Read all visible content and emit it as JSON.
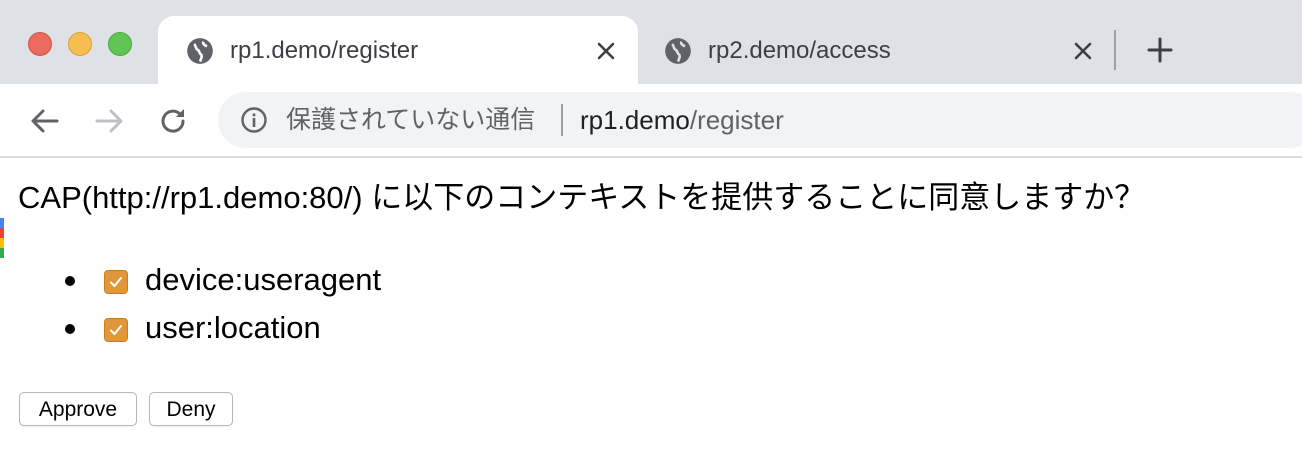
{
  "window_controls": {
    "close_color": "#ed6a5e",
    "minimize_color": "#f5be4f",
    "zoom_color": "#61c554"
  },
  "tabs": [
    {
      "title": "rp1.demo/register",
      "icon": "globe-icon",
      "active": true
    },
    {
      "title": "rp2.demo/access",
      "icon": "globe-icon",
      "active": false
    }
  ],
  "toolbar": {
    "security_label": "保護されていない通信",
    "url_host": "rp1.demo",
    "url_path": "/register"
  },
  "page": {
    "question": "CAP(http://rp1.demo:80/) に以下のコンテキストを提供することに同意しますか？",
    "contexts": [
      {
        "label": "device:useragent",
        "checked": true
      },
      {
        "label": "user:location",
        "checked": true
      }
    ],
    "approve_label": "Approve",
    "deny_label": "Deny"
  },
  "colors": {
    "checkbox_accent": "#e1963a",
    "tabstrip_bg": "#dee1e6",
    "omnibox_bg": "#f1f3f4"
  }
}
